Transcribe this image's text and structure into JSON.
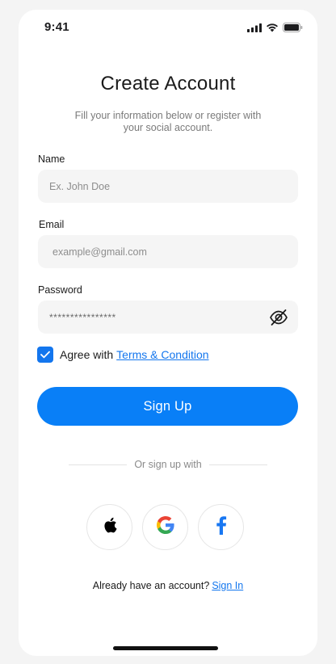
{
  "status_bar": {
    "time": "9:41",
    "icons": [
      "signal-icon",
      "wifi-icon",
      "battery-icon"
    ]
  },
  "header": {
    "title": "Create Account",
    "subtitle": "Fill your information below or register with your social account."
  },
  "form": {
    "name": {
      "label": "Name",
      "placeholder": "Ex. John Doe"
    },
    "email": {
      "label": "Email",
      "placeholder": "example@gmail.com"
    },
    "password": {
      "label": "Password",
      "value": "****************",
      "toggle_icon": "eye-off-icon"
    },
    "agree": {
      "checked": true,
      "text": "Agree with",
      "link": "Terms & Condition"
    },
    "submit_label": "Sign Up"
  },
  "social": {
    "divider_text": "Or sign up with",
    "providers": [
      "apple",
      "google",
      "facebook"
    ]
  },
  "footer": {
    "prompt": "Already  have an account?",
    "link": "Sign In"
  },
  "colors": {
    "primary": "#097ff7",
    "link": "#1376ee",
    "input_bg": "#f5f5f5",
    "background": "#f4f4f4"
  }
}
